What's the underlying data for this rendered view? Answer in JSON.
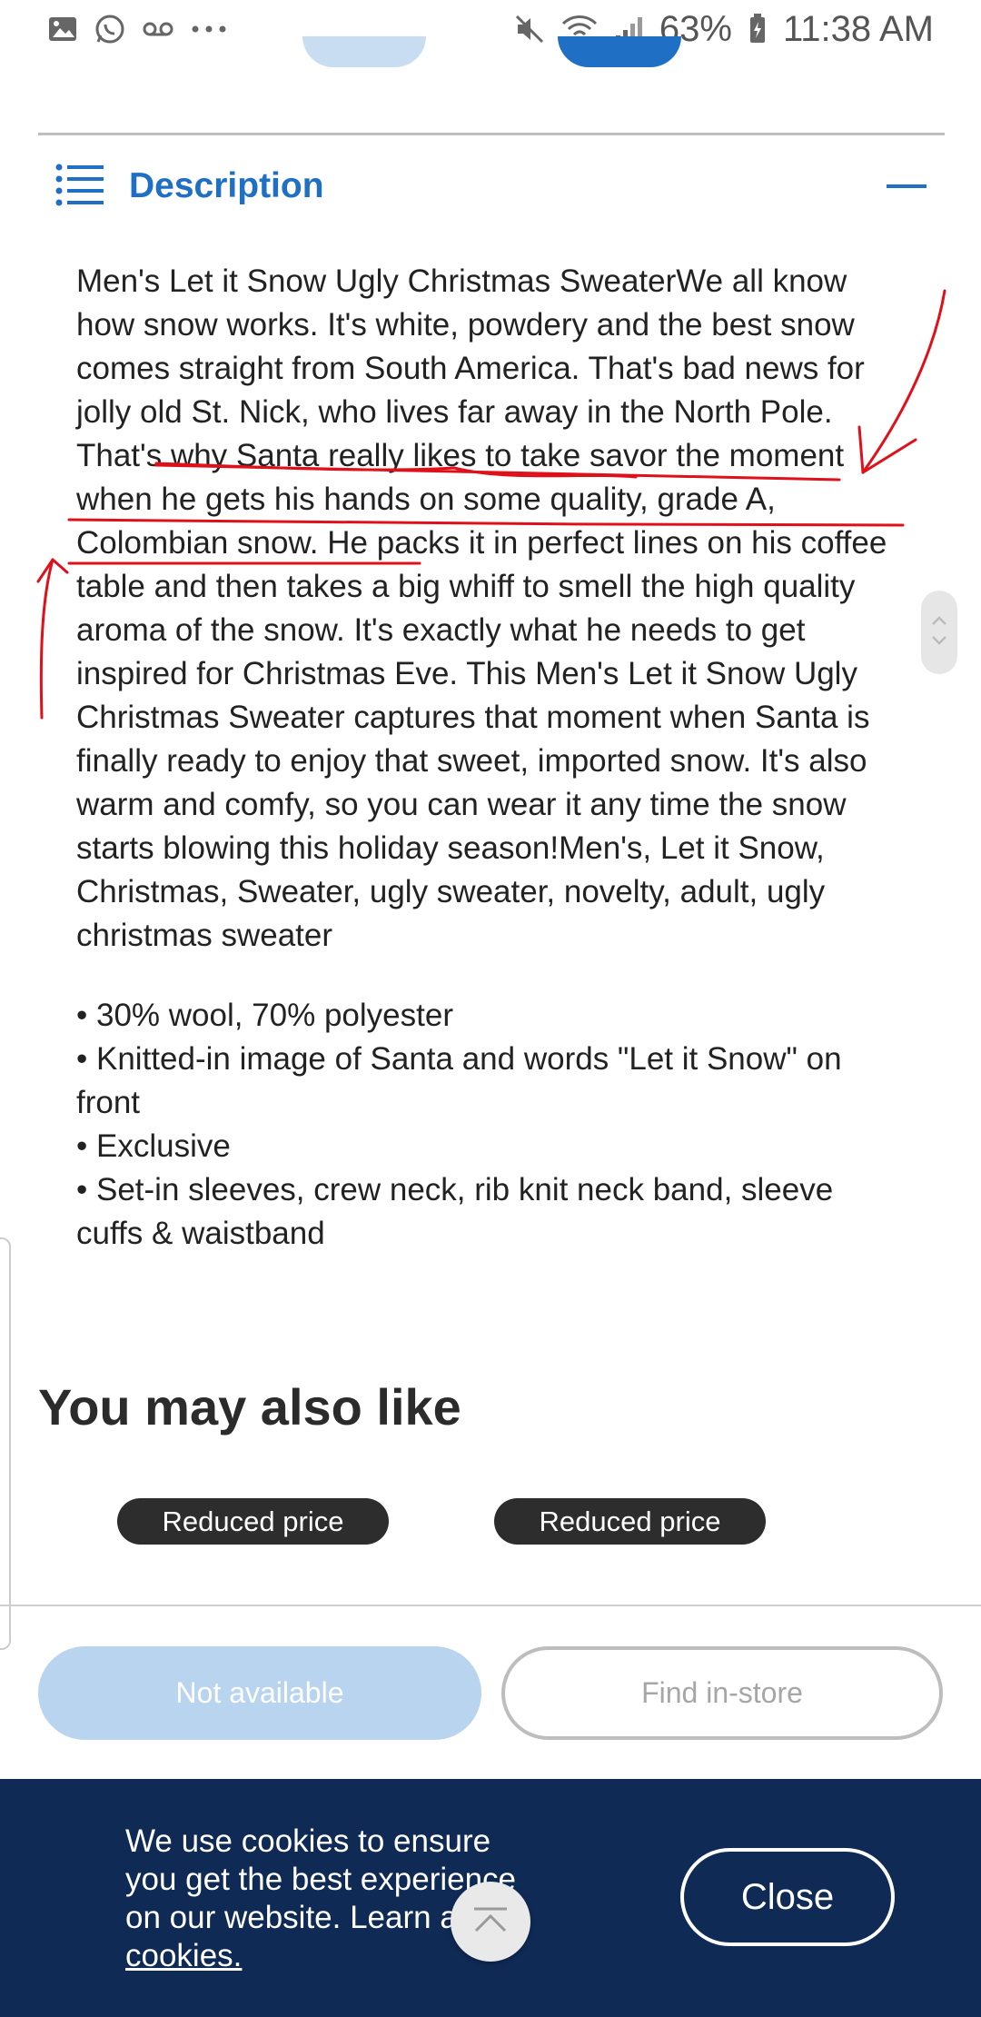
{
  "status_bar": {
    "battery": "63%",
    "time": "11:38 AM",
    "icons": [
      "gallery-icon",
      "whatsapp-icon",
      "voicemail-icon",
      "more-icon",
      "mute-icon",
      "wifi-icon",
      "signal-icon",
      "battery-icon"
    ]
  },
  "description": {
    "title": "Description",
    "text": "Men's Let it Snow Ugly Christmas SweaterWe all know how snow works. It's white, powdery and the best snow comes straight from South America. That's bad news for jolly old St. Nick, who lives far away in the North Pole. That's why Santa really likes to take savor the moment when he gets his hands on some quality, grade A, Colombian snow. He packs it in perfect lines on his coffee table and then takes a big whiff to smell the high quality aroma of the snow. It's exactly what he needs to get inspired for Christmas Eve. This Men's Let it Snow Ugly Christmas Sweater captures that moment when Santa is finally ready to enjoy that sweet, imported snow. It's also warm and comfy, so you can wear it any time the snow starts blowing this holiday season!Men's, Let it Snow, Christmas, Sweater, ugly sweater, novelty, adult, ugly christmas sweater",
    "bullets": [
      "• 30% wool, 70% polyester",
      "• Knitted-in image of Santa and words \"Let it Snow\" on front",
      "• Exclusive",
      "• Set-in sleeves, crew neck, rib knit neck band, sleeve cuffs & waistband"
    ]
  },
  "also_like": {
    "title": "You may also like",
    "badges": [
      "Reduced price",
      "Reduced price"
    ]
  },
  "actions": {
    "not_available": "Not available",
    "find_in_store": "Find in-store"
  },
  "cookie": {
    "text": "We use cookies to ensure you get the best experience on our website. Learn about ",
    "link": "cookies.",
    "close": "Close"
  },
  "colors": {
    "accent": "#1f6fc5",
    "banner": "#0f2a55",
    "annotation": "#e0101a"
  }
}
